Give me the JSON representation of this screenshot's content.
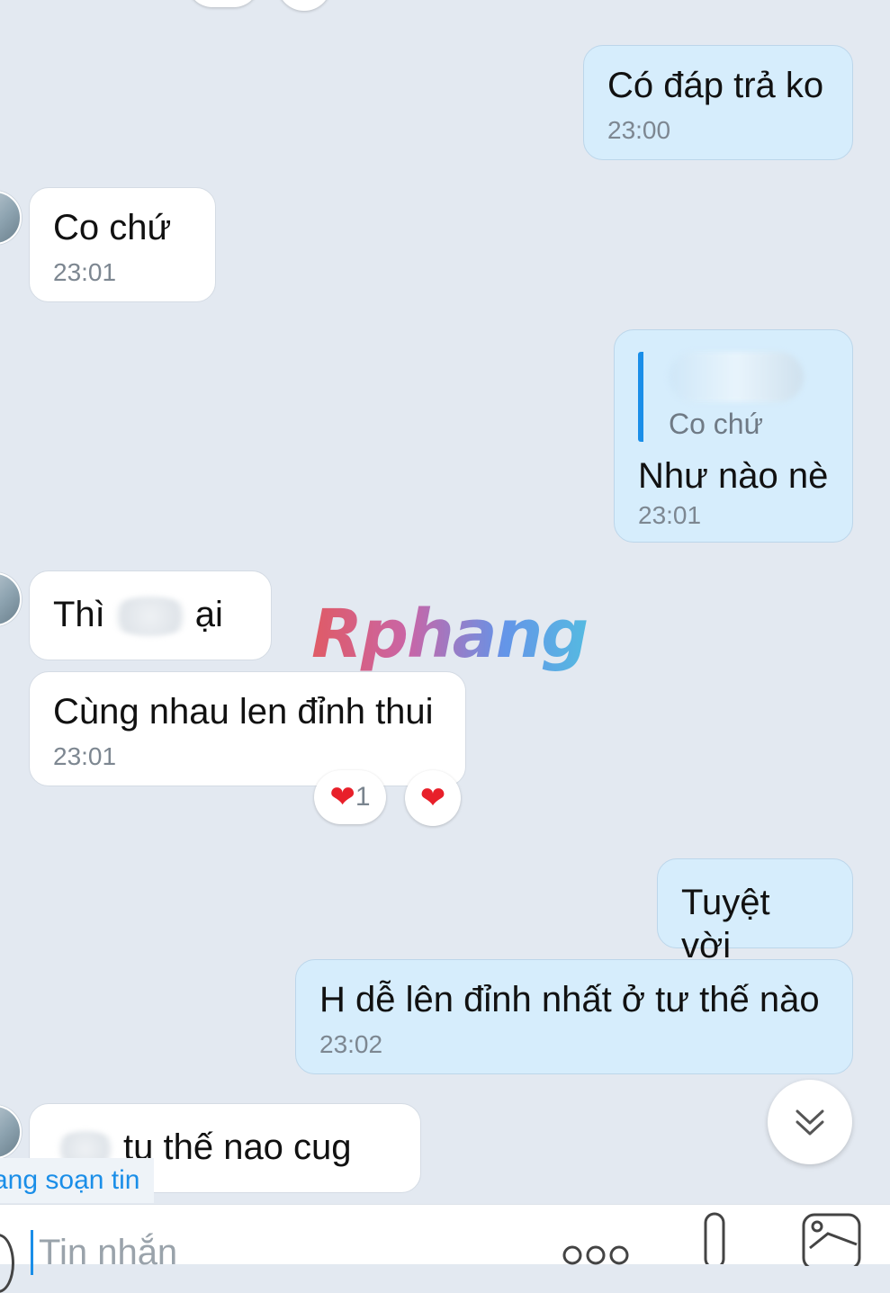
{
  "messages": {
    "m1": {
      "text": "Có đáp trả ko",
      "time": "23:00"
    },
    "m2": {
      "text": "Co chứ",
      "time": "23:01"
    },
    "m3": {
      "quote": "Co chứ",
      "text": "Như nào nè",
      "time": "23:01"
    },
    "m4": {
      "text_start": "Thì",
      "text_end": "ại"
    },
    "m5": {
      "text": "Cùng nhau len đỉnh thui",
      "time": "23:01"
    },
    "m6": {
      "text": "Tuyệt vời"
    },
    "m7": {
      "text": "H dễ lên đỉnh nhất ở tư thế nào",
      "time": "23:02"
    },
    "m8": {
      "text": "tu thế nao cug đc"
    }
  },
  "reactions": {
    "count_heart": "❤",
    "count": "1",
    "add_heart": "❤"
  },
  "typing_indicator": "ang soạn tin",
  "composer": {
    "placeholder": "Tin nhắn"
  },
  "watermark": "Rphang",
  "colors": {
    "accent": "#1a8ee8",
    "outgoing": "#d6edfc",
    "incoming": "#ffffff",
    "background": "#e3e9f1"
  }
}
